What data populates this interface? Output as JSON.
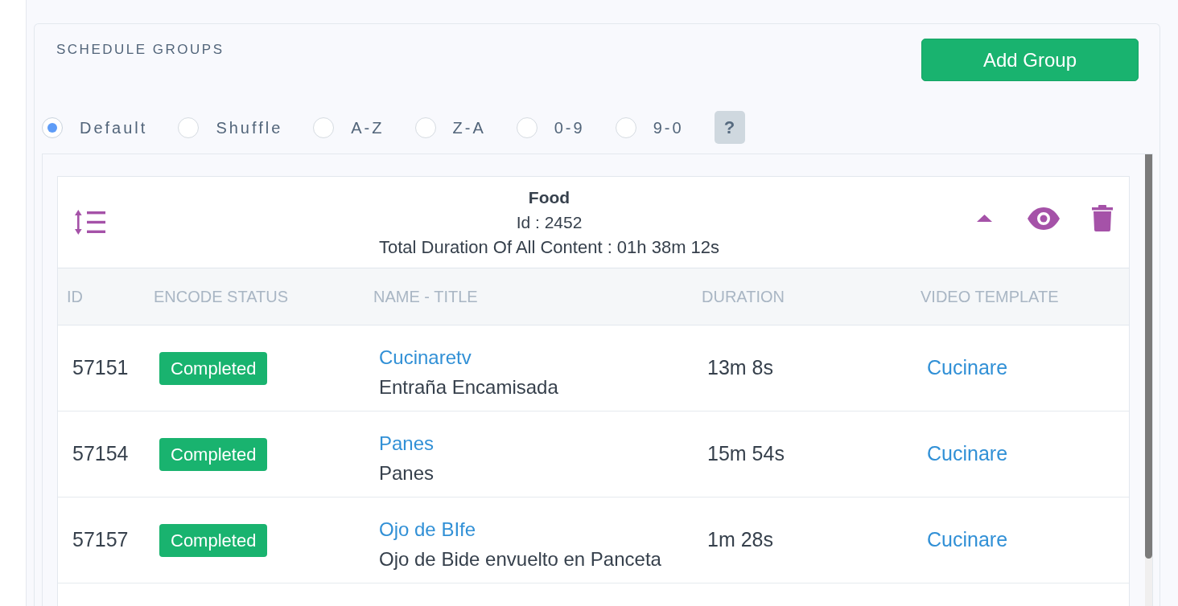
{
  "panel": {
    "title": "SCHEDULE GROUPS",
    "add_button": "Add Group"
  },
  "sort_options": [
    {
      "label": "Default",
      "selected": true
    },
    {
      "label": "Shuffle",
      "selected": false
    },
    {
      "label": "A-Z",
      "selected": false
    },
    {
      "label": "Z-A",
      "selected": false
    },
    {
      "label": "0-9",
      "selected": false
    },
    {
      "label": "9-0",
      "selected": false
    }
  ],
  "help_button": "?",
  "groups": [
    {
      "title": "Food",
      "id": "Id : 2452",
      "total_duration": "Total Duration Of All Content : 01h 38m 12s",
      "expanded": true,
      "columns": [
        "ID",
        "ENCODE STATUS",
        "NAME - TITLE",
        "DURATION",
        "VIDEO TEMPLATE"
      ],
      "rows": [
        {
          "id": "57151",
          "encode_status": "Completed",
          "name": "Cucinaretv",
          "title": "Entraña Encamisada",
          "duration": "13m 8s",
          "video_template": "Cucinare"
        },
        {
          "id": "57154",
          "encode_status": "Completed",
          "name": "Panes",
          "title": "Panes",
          "duration": "15m 54s",
          "video_template": "Cucinare"
        },
        {
          "id": "57157",
          "encode_status": "Completed",
          "name": "Ojo de BIfe",
          "title": "Ojo de Bide envuelto en Panceta",
          "duration": "1m 28s",
          "video_template": "Cucinare"
        }
      ]
    }
  ]
}
